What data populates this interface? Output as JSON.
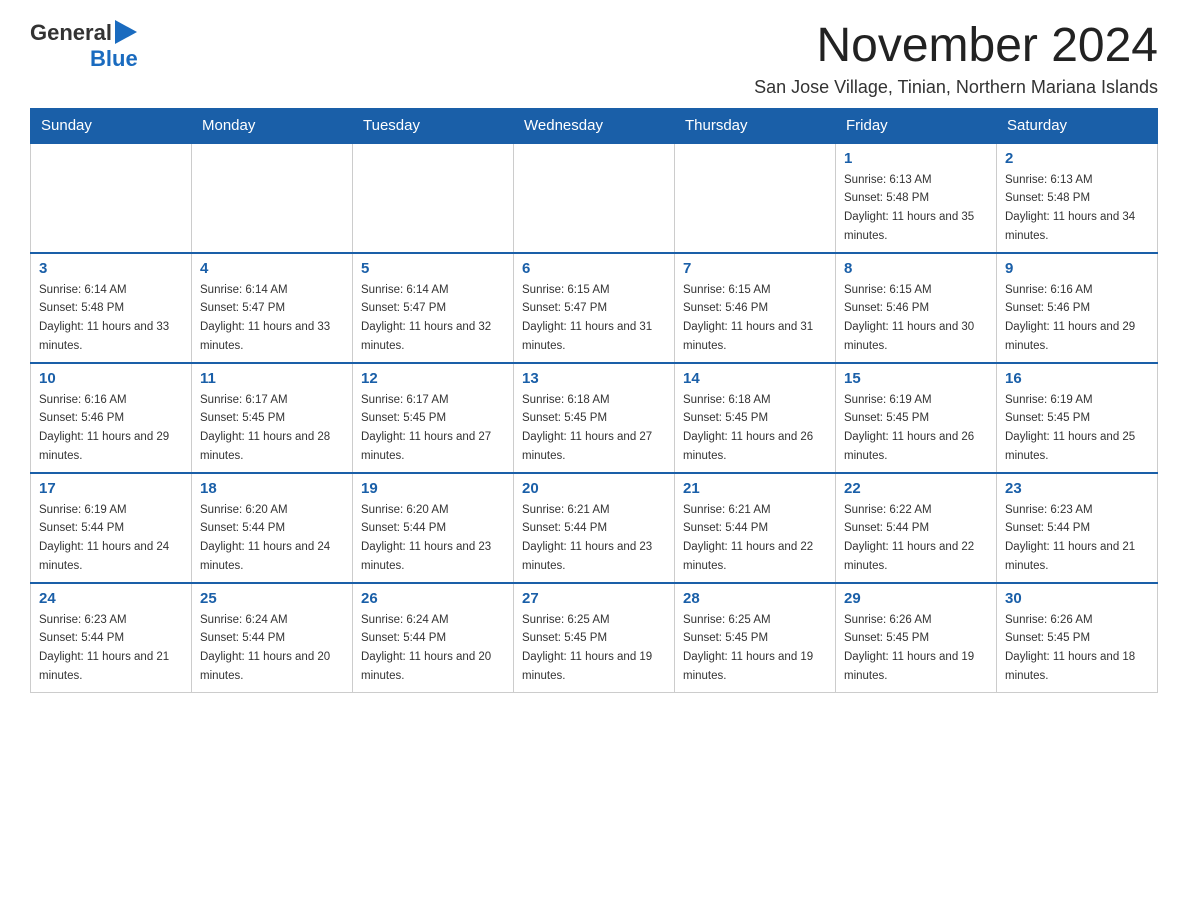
{
  "header": {
    "logo_general": "General",
    "logo_blue": "Blue",
    "title": "November 2024",
    "subtitle": "San Jose Village, Tinian, Northern Mariana Islands"
  },
  "days_of_week": [
    "Sunday",
    "Monday",
    "Tuesday",
    "Wednesday",
    "Thursday",
    "Friday",
    "Saturday"
  ],
  "weeks": [
    [
      {
        "day": "",
        "sunrise": "",
        "sunset": "",
        "daylight": ""
      },
      {
        "day": "",
        "sunrise": "",
        "sunset": "",
        "daylight": ""
      },
      {
        "day": "",
        "sunrise": "",
        "sunset": "",
        "daylight": ""
      },
      {
        "day": "",
        "sunrise": "",
        "sunset": "",
        "daylight": ""
      },
      {
        "day": "",
        "sunrise": "",
        "sunset": "",
        "daylight": ""
      },
      {
        "day": "1",
        "sunrise": "Sunrise: 6:13 AM",
        "sunset": "Sunset: 5:48 PM",
        "daylight": "Daylight: 11 hours and 35 minutes."
      },
      {
        "day": "2",
        "sunrise": "Sunrise: 6:13 AM",
        "sunset": "Sunset: 5:48 PM",
        "daylight": "Daylight: 11 hours and 34 minutes."
      }
    ],
    [
      {
        "day": "3",
        "sunrise": "Sunrise: 6:14 AM",
        "sunset": "Sunset: 5:48 PM",
        "daylight": "Daylight: 11 hours and 33 minutes."
      },
      {
        "day": "4",
        "sunrise": "Sunrise: 6:14 AM",
        "sunset": "Sunset: 5:47 PM",
        "daylight": "Daylight: 11 hours and 33 minutes."
      },
      {
        "day": "5",
        "sunrise": "Sunrise: 6:14 AM",
        "sunset": "Sunset: 5:47 PM",
        "daylight": "Daylight: 11 hours and 32 minutes."
      },
      {
        "day": "6",
        "sunrise": "Sunrise: 6:15 AM",
        "sunset": "Sunset: 5:47 PM",
        "daylight": "Daylight: 11 hours and 31 minutes."
      },
      {
        "day": "7",
        "sunrise": "Sunrise: 6:15 AM",
        "sunset": "Sunset: 5:46 PM",
        "daylight": "Daylight: 11 hours and 31 minutes."
      },
      {
        "day": "8",
        "sunrise": "Sunrise: 6:15 AM",
        "sunset": "Sunset: 5:46 PM",
        "daylight": "Daylight: 11 hours and 30 minutes."
      },
      {
        "day": "9",
        "sunrise": "Sunrise: 6:16 AM",
        "sunset": "Sunset: 5:46 PM",
        "daylight": "Daylight: 11 hours and 29 minutes."
      }
    ],
    [
      {
        "day": "10",
        "sunrise": "Sunrise: 6:16 AM",
        "sunset": "Sunset: 5:46 PM",
        "daylight": "Daylight: 11 hours and 29 minutes."
      },
      {
        "day": "11",
        "sunrise": "Sunrise: 6:17 AM",
        "sunset": "Sunset: 5:45 PM",
        "daylight": "Daylight: 11 hours and 28 minutes."
      },
      {
        "day": "12",
        "sunrise": "Sunrise: 6:17 AM",
        "sunset": "Sunset: 5:45 PM",
        "daylight": "Daylight: 11 hours and 27 minutes."
      },
      {
        "day": "13",
        "sunrise": "Sunrise: 6:18 AM",
        "sunset": "Sunset: 5:45 PM",
        "daylight": "Daylight: 11 hours and 27 minutes."
      },
      {
        "day": "14",
        "sunrise": "Sunrise: 6:18 AM",
        "sunset": "Sunset: 5:45 PM",
        "daylight": "Daylight: 11 hours and 26 minutes."
      },
      {
        "day": "15",
        "sunrise": "Sunrise: 6:19 AM",
        "sunset": "Sunset: 5:45 PM",
        "daylight": "Daylight: 11 hours and 26 minutes."
      },
      {
        "day": "16",
        "sunrise": "Sunrise: 6:19 AM",
        "sunset": "Sunset: 5:45 PM",
        "daylight": "Daylight: 11 hours and 25 minutes."
      }
    ],
    [
      {
        "day": "17",
        "sunrise": "Sunrise: 6:19 AM",
        "sunset": "Sunset: 5:44 PM",
        "daylight": "Daylight: 11 hours and 24 minutes."
      },
      {
        "day": "18",
        "sunrise": "Sunrise: 6:20 AM",
        "sunset": "Sunset: 5:44 PM",
        "daylight": "Daylight: 11 hours and 24 minutes."
      },
      {
        "day": "19",
        "sunrise": "Sunrise: 6:20 AM",
        "sunset": "Sunset: 5:44 PM",
        "daylight": "Daylight: 11 hours and 23 minutes."
      },
      {
        "day": "20",
        "sunrise": "Sunrise: 6:21 AM",
        "sunset": "Sunset: 5:44 PM",
        "daylight": "Daylight: 11 hours and 23 minutes."
      },
      {
        "day": "21",
        "sunrise": "Sunrise: 6:21 AM",
        "sunset": "Sunset: 5:44 PM",
        "daylight": "Daylight: 11 hours and 22 minutes."
      },
      {
        "day": "22",
        "sunrise": "Sunrise: 6:22 AM",
        "sunset": "Sunset: 5:44 PM",
        "daylight": "Daylight: 11 hours and 22 minutes."
      },
      {
        "day": "23",
        "sunrise": "Sunrise: 6:23 AM",
        "sunset": "Sunset: 5:44 PM",
        "daylight": "Daylight: 11 hours and 21 minutes."
      }
    ],
    [
      {
        "day": "24",
        "sunrise": "Sunrise: 6:23 AM",
        "sunset": "Sunset: 5:44 PM",
        "daylight": "Daylight: 11 hours and 21 minutes."
      },
      {
        "day": "25",
        "sunrise": "Sunrise: 6:24 AM",
        "sunset": "Sunset: 5:44 PM",
        "daylight": "Daylight: 11 hours and 20 minutes."
      },
      {
        "day": "26",
        "sunrise": "Sunrise: 6:24 AM",
        "sunset": "Sunset: 5:44 PM",
        "daylight": "Daylight: 11 hours and 20 minutes."
      },
      {
        "day": "27",
        "sunrise": "Sunrise: 6:25 AM",
        "sunset": "Sunset: 5:45 PM",
        "daylight": "Daylight: 11 hours and 19 minutes."
      },
      {
        "day": "28",
        "sunrise": "Sunrise: 6:25 AM",
        "sunset": "Sunset: 5:45 PM",
        "daylight": "Daylight: 11 hours and 19 minutes."
      },
      {
        "day": "29",
        "sunrise": "Sunrise: 6:26 AM",
        "sunset": "Sunset: 5:45 PM",
        "daylight": "Daylight: 11 hours and 19 minutes."
      },
      {
        "day": "30",
        "sunrise": "Sunrise: 6:26 AM",
        "sunset": "Sunset: 5:45 PM",
        "daylight": "Daylight: 11 hours and 18 minutes."
      }
    ]
  ]
}
